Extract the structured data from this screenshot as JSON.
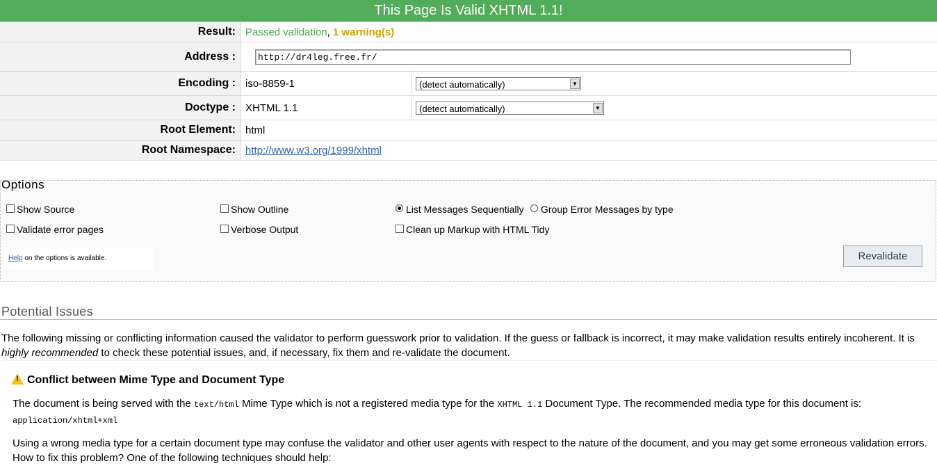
{
  "banner": "This Page Is Valid XHTML 1.1!",
  "rows": {
    "result_label": "Result:",
    "result_passed": "Passed validation",
    "result_sep": ", ",
    "result_warn": "1 warning(s)",
    "address_label": "Address :",
    "address_value": "http://dr4leg.free.fr/",
    "encoding_label": "Encoding :",
    "encoding_value": "iso-8859-1",
    "encoding_select": "(detect automatically)",
    "doctype_label": "Doctype :",
    "doctype_value": "XHTML 1.1",
    "doctype_select": "(detect automatically)",
    "root_label": "Root Element:",
    "root_value": "html",
    "ns_label": "Root Namespace:",
    "ns_value": "http://www.w3.org/1999/xhtml"
  },
  "options": {
    "title": "Options",
    "show_source": "Show Source",
    "show_outline": "Show Outline",
    "list_seq": "List Messages Sequentially",
    "group_err": "Group Error Messages by type",
    "validate_err": "Validate error pages",
    "verbose": "Verbose Output",
    "tidy": "Clean up Markup with HTML Tidy",
    "help_link": "Help",
    "help_rest": " on the options is available.",
    "revalidate": "Revalidate"
  },
  "issues": {
    "title": "Potential Issues",
    "intro_1": "The following missing or conflicting information caused the validator to perform guesswork prior to validation. If the guess or fallback is incorrect, it may make validation results entirely incoherent. It is",
    "intro_em": "highly recommended",
    "intro_2": " to check these potential issues, and, if necessary, fix them and re-validate the document.",
    "conflict_title": "Conflict between Mime Type and Document Type",
    "p1_a": "The document is being served with the ",
    "p1_code1": "text/html",
    "p1_b": " Mime Type which is not a registered media type for the ",
    "p1_code2": "XHTML 1.1",
    "p1_c": " Document Type. The recommended media type for this document is:",
    "p1_code3": "application/xhtml+xml",
    "p2": "Using a wrong media type for a certain document type may confuse the validator and other user agents with respect to the nature of the document, and you may get some erroneous validation errors. How to fix this problem? One of the following techniques should help:"
  }
}
